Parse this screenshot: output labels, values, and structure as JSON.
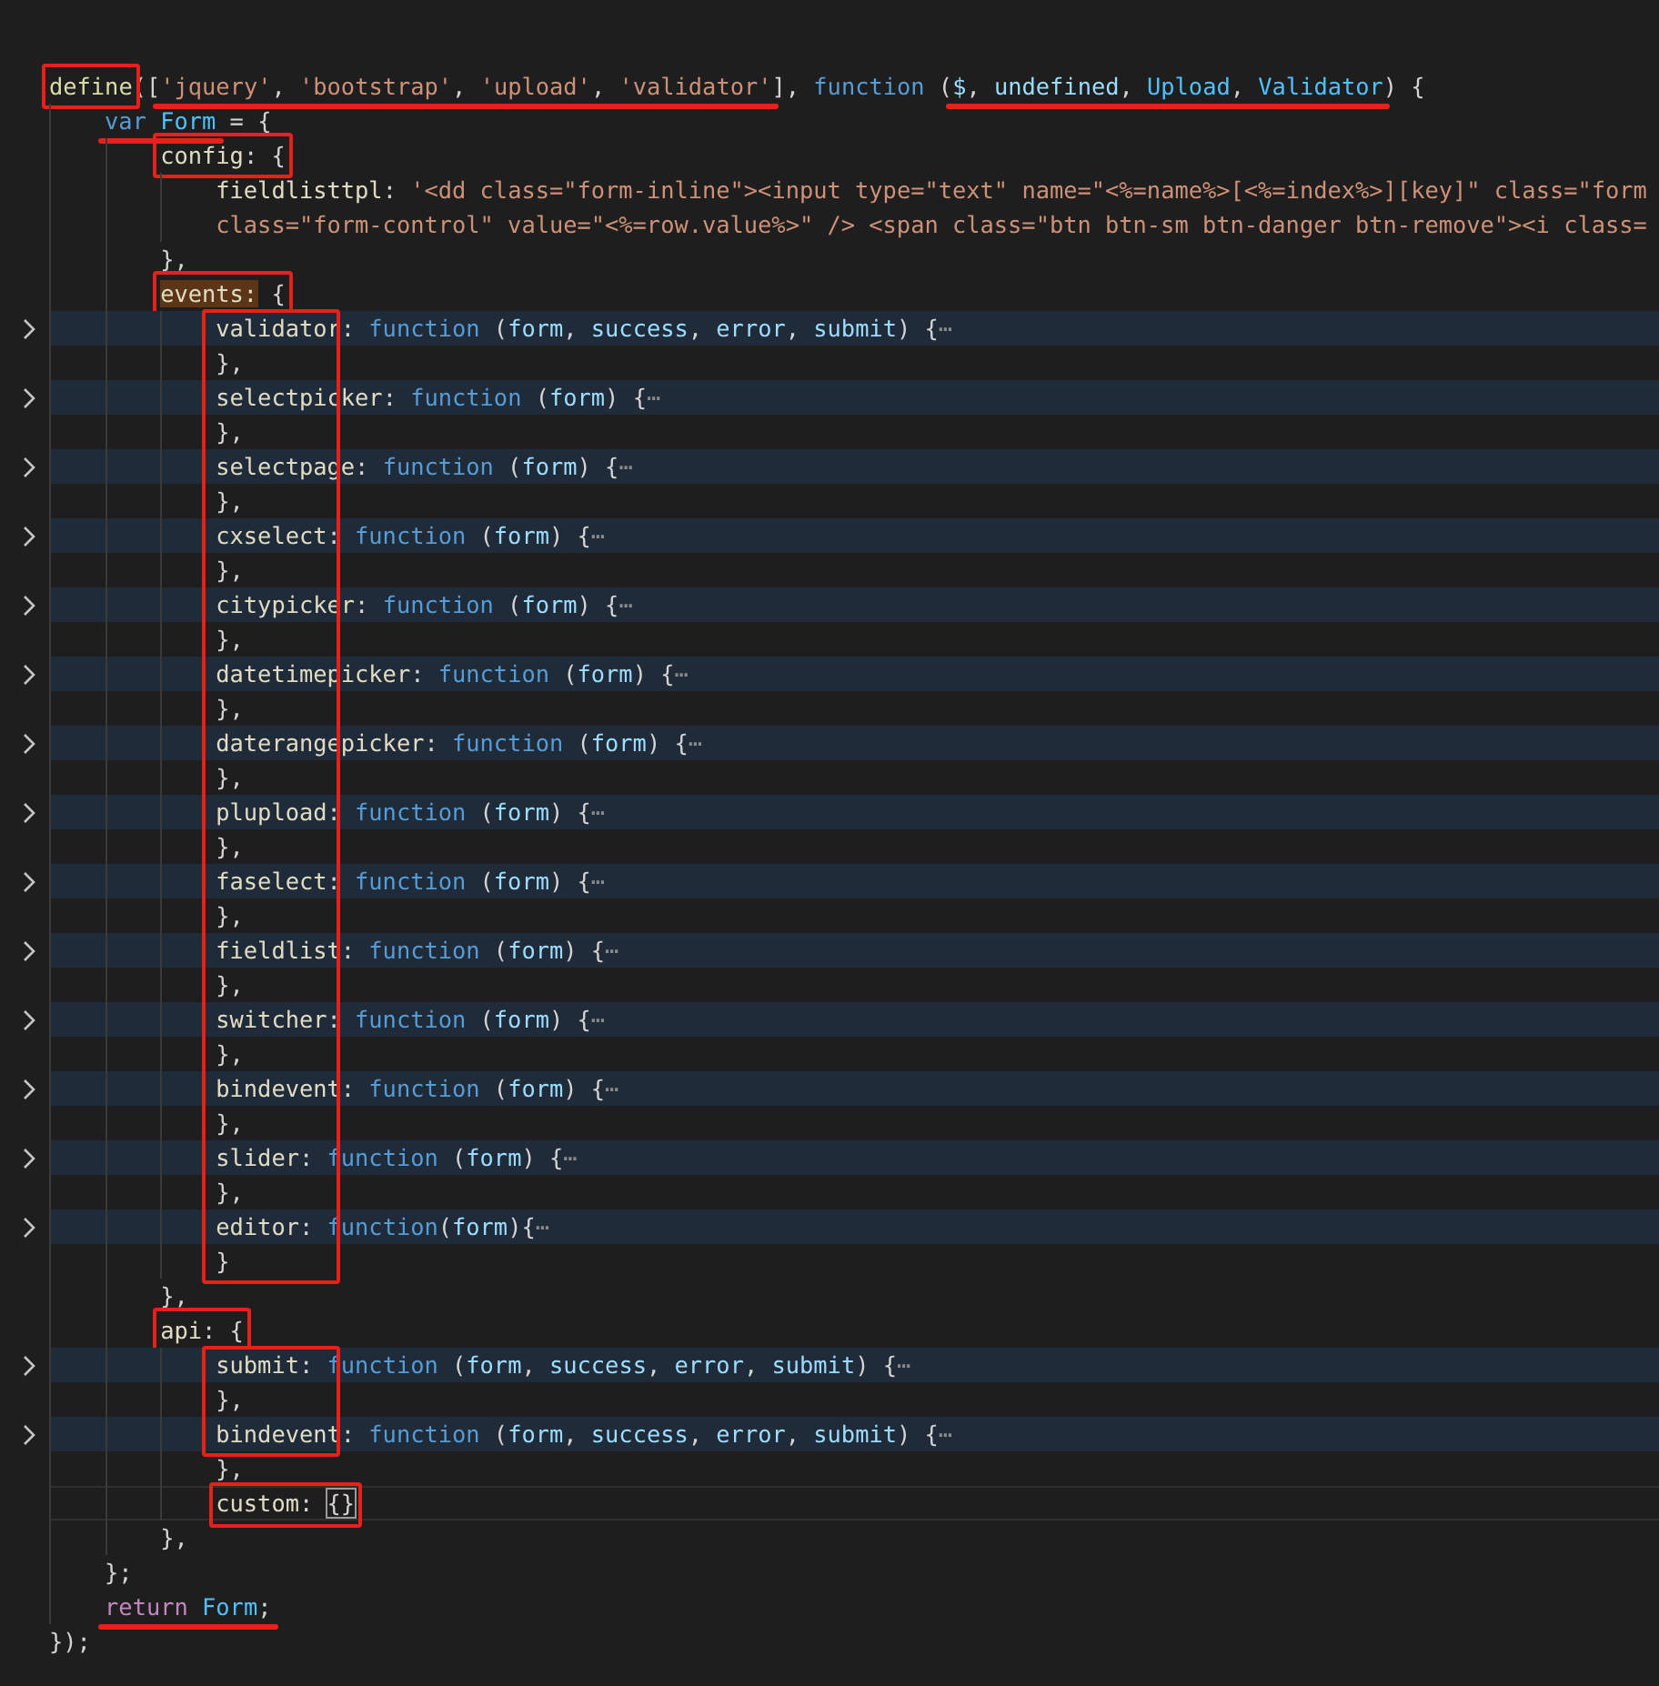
{
  "editor": {
    "lines": [
      {
        "tokens": [
          {
            "kind": "fn",
            "text": "define",
            "box_from": true,
            "box_to": true
          },
          {
            "kind": "p",
            "text": "(["
          },
          {
            "kind": "str",
            "text": "'jquery'",
            "underline_from": true
          },
          {
            "kind": "p",
            "text": ", "
          },
          {
            "kind": "str",
            "text": "'bootstrap'"
          },
          {
            "kind": "p",
            "text": ", "
          },
          {
            "kind": "str",
            "text": "'upload'"
          },
          {
            "kind": "p",
            "text": ", "
          },
          {
            "kind": "str",
            "text": "'validator'",
            "underline_to": true
          },
          {
            "kind": "p",
            "text": "], "
          },
          {
            "kind": "kw",
            "text": "function"
          },
          {
            "kind": "p",
            "text": " ("
          },
          {
            "kind": "param",
            "text": "$",
            "underline_from": true
          },
          {
            "kind": "p",
            "text": ", "
          },
          {
            "kind": "param",
            "text": "undefined"
          },
          {
            "kind": "p",
            "text": ", "
          },
          {
            "kind": "cls",
            "text": "Upload"
          },
          {
            "kind": "p",
            "text": ", "
          },
          {
            "kind": "cls",
            "text": "Validator",
            "underline_to": true
          },
          {
            "kind": "p",
            "text": ") {"
          }
        ],
        "children": [
          {
            "tokens": [
              {
                "kind": "kw",
                "text": "var ",
                "underline_from": true
              },
              {
                "kind": "cls",
                "text": "Form",
                "underline_to": true
              },
              {
                "kind": "p",
                "text": " = {"
              }
            ],
            "children": [
              {
                "tokens": [
                  {
                    "kind": "key",
                    "text": "config",
                    "box_from": true
                  },
                  {
                    "kind": "p",
                    "text": ": {",
                    "box_to": true
                  }
                ],
                "children": [
                  {
                    "tokens": [
                      {
                        "kind": "key",
                        "text": "fieldlisttpl"
                      },
                      {
                        "kind": "p",
                        "text": ": "
                      },
                      {
                        "kind": "str",
                        "text": "'<dd class=\"form-inline\"><input type=\"text\" name=\"<%=name%>[<%=index%>][key]\" class=\"form"
                      }
                    ]
                  },
                  {
                    "tokens": [
                      {
                        "kind": "str",
                        "text": "class=\"form-control\" value=\"<%=row.value%>\" /> <span class=\"btn btn-sm btn-danger btn-remove\"><i class="
                      }
                    ]
                  }
                ]
              },
              {
                "tokens": [
                  {
                    "kind": "p",
                    "text": "},"
                  }
                ]
              },
              {
                "tokens": [
                  {
                    "kind": "key",
                    "text": "events:",
                    "highlight": true,
                    "box_from": true
                  },
                  {
                    "kind": "p",
                    "text": " {",
                    "box_to": true
                  }
                ],
                "children": [
                  {
                    "box_from": true,
                    "folded": true,
                    "tokens": [
                      {
                        "kind": "key",
                        "text": "validator"
                      },
                      {
                        "kind": "p",
                        "text": ": "
                      },
                      {
                        "kind": "kw",
                        "text": "function"
                      },
                      {
                        "kind": "p",
                        "text": " ("
                      },
                      {
                        "kind": "param",
                        "text": "form"
                      },
                      {
                        "kind": "p",
                        "text": ", "
                      },
                      {
                        "kind": "param",
                        "text": "success"
                      },
                      {
                        "kind": "p",
                        "text": ", "
                      },
                      {
                        "kind": "param",
                        "text": "error"
                      },
                      {
                        "kind": "p",
                        "text": ", "
                      },
                      {
                        "kind": "param",
                        "text": "submit"
                      },
                      {
                        "kind": "p",
                        "text": ") {"
                      },
                      {
                        "kind": "fold",
                        "text": "⋯"
                      }
                    ]
                  },
                  {
                    "tokens": [
                      {
                        "kind": "p",
                        "text": "},"
                      }
                    ]
                  },
                  {
                    "folded": true,
                    "tokens": [
                      {
                        "kind": "key",
                        "text": "selectpicker"
                      },
                      {
                        "kind": "p",
                        "text": ": "
                      },
                      {
                        "kind": "kw",
                        "text": "function"
                      },
                      {
                        "kind": "p",
                        "text": " ("
                      },
                      {
                        "kind": "param",
                        "text": "form"
                      },
                      {
                        "kind": "p",
                        "text": ") {"
                      },
                      {
                        "kind": "fold",
                        "text": "⋯"
                      }
                    ]
                  },
                  {
                    "tokens": [
                      {
                        "kind": "p",
                        "text": "},"
                      }
                    ]
                  },
                  {
                    "folded": true,
                    "tokens": [
                      {
                        "kind": "key",
                        "text": "selectpage"
                      },
                      {
                        "kind": "p",
                        "text": ": "
                      },
                      {
                        "kind": "kw",
                        "text": "function"
                      },
                      {
                        "kind": "p",
                        "text": " ("
                      },
                      {
                        "kind": "param",
                        "text": "form"
                      },
                      {
                        "kind": "p",
                        "text": ") {"
                      },
                      {
                        "kind": "fold",
                        "text": "⋯"
                      }
                    ]
                  },
                  {
                    "tokens": [
                      {
                        "kind": "p",
                        "text": "},"
                      }
                    ]
                  },
                  {
                    "folded": true,
                    "tokens": [
                      {
                        "kind": "key",
                        "text": "cxselect"
                      },
                      {
                        "kind": "p",
                        "text": ": "
                      },
                      {
                        "kind": "kw",
                        "text": "function"
                      },
                      {
                        "kind": "p",
                        "text": " ("
                      },
                      {
                        "kind": "param",
                        "text": "form"
                      },
                      {
                        "kind": "p",
                        "text": ") {"
                      },
                      {
                        "kind": "fold",
                        "text": "⋯"
                      }
                    ]
                  },
                  {
                    "tokens": [
                      {
                        "kind": "p",
                        "text": "},"
                      }
                    ]
                  },
                  {
                    "folded": true,
                    "tokens": [
                      {
                        "kind": "key",
                        "text": "citypicker"
                      },
                      {
                        "kind": "p",
                        "text": ": "
                      },
                      {
                        "kind": "kw",
                        "text": "function"
                      },
                      {
                        "kind": "p",
                        "text": " ("
                      },
                      {
                        "kind": "param",
                        "text": "form"
                      },
                      {
                        "kind": "p",
                        "text": ") {"
                      },
                      {
                        "kind": "fold",
                        "text": "⋯"
                      }
                    ]
                  },
                  {
                    "tokens": [
                      {
                        "kind": "p",
                        "text": "},"
                      }
                    ]
                  },
                  {
                    "folded": true,
                    "tokens": [
                      {
                        "kind": "key",
                        "text": "datetimepicker"
                      },
                      {
                        "kind": "p",
                        "text": ": "
                      },
                      {
                        "kind": "kw",
                        "text": "function"
                      },
                      {
                        "kind": "p",
                        "text": " ("
                      },
                      {
                        "kind": "param",
                        "text": "form"
                      },
                      {
                        "kind": "p",
                        "text": ") {"
                      },
                      {
                        "kind": "fold",
                        "text": "⋯"
                      }
                    ]
                  },
                  {
                    "tokens": [
                      {
                        "kind": "p",
                        "text": "},"
                      }
                    ]
                  },
                  {
                    "folded": true,
                    "tokens": [
                      {
                        "kind": "key",
                        "text": "daterangepicker"
                      },
                      {
                        "kind": "p",
                        "text": ": "
                      },
                      {
                        "kind": "kw",
                        "text": "function"
                      },
                      {
                        "kind": "p",
                        "text": " ("
                      },
                      {
                        "kind": "param",
                        "text": "form"
                      },
                      {
                        "kind": "p",
                        "text": ") {"
                      },
                      {
                        "kind": "fold",
                        "text": "⋯"
                      }
                    ]
                  },
                  {
                    "tokens": [
                      {
                        "kind": "p",
                        "text": "},"
                      }
                    ]
                  },
                  {
                    "folded": true,
                    "tokens": [
                      {
                        "kind": "key",
                        "text": "plupload"
                      },
                      {
                        "kind": "p",
                        "text": ": "
                      },
                      {
                        "kind": "kw",
                        "text": "function"
                      },
                      {
                        "kind": "p",
                        "text": " ("
                      },
                      {
                        "kind": "param",
                        "text": "form"
                      },
                      {
                        "kind": "p",
                        "text": ") {"
                      },
                      {
                        "kind": "fold",
                        "text": "⋯"
                      }
                    ]
                  },
                  {
                    "tokens": [
                      {
                        "kind": "p",
                        "text": "},"
                      }
                    ]
                  },
                  {
                    "folded": true,
                    "tokens": [
                      {
                        "kind": "key",
                        "text": "faselect"
                      },
                      {
                        "kind": "p",
                        "text": ": "
                      },
                      {
                        "kind": "kw",
                        "text": "function"
                      },
                      {
                        "kind": "p",
                        "text": " ("
                      },
                      {
                        "kind": "param",
                        "text": "form"
                      },
                      {
                        "kind": "p",
                        "text": ") {"
                      },
                      {
                        "kind": "fold",
                        "text": "⋯"
                      }
                    ]
                  },
                  {
                    "tokens": [
                      {
                        "kind": "p",
                        "text": "},"
                      }
                    ]
                  },
                  {
                    "folded": true,
                    "tokens": [
                      {
                        "kind": "key",
                        "text": "fieldlist"
                      },
                      {
                        "kind": "p",
                        "text": ": "
                      },
                      {
                        "kind": "kw",
                        "text": "function"
                      },
                      {
                        "kind": "p",
                        "text": " ("
                      },
                      {
                        "kind": "param",
                        "text": "form"
                      },
                      {
                        "kind": "p",
                        "text": ") {"
                      },
                      {
                        "kind": "fold",
                        "text": "⋯"
                      }
                    ]
                  },
                  {
                    "tokens": [
                      {
                        "kind": "p",
                        "text": "},"
                      }
                    ]
                  },
                  {
                    "folded": true,
                    "tokens": [
                      {
                        "kind": "key",
                        "text": "switcher"
                      },
                      {
                        "kind": "p",
                        "text": ": "
                      },
                      {
                        "kind": "kw",
                        "text": "function"
                      },
                      {
                        "kind": "p",
                        "text": " ("
                      },
                      {
                        "kind": "param",
                        "text": "form"
                      },
                      {
                        "kind": "p",
                        "text": ") {"
                      },
                      {
                        "kind": "fold",
                        "text": "⋯"
                      }
                    ]
                  },
                  {
                    "tokens": [
                      {
                        "kind": "p",
                        "text": "},"
                      }
                    ]
                  },
                  {
                    "folded": true,
                    "tokens": [
                      {
                        "kind": "key",
                        "text": "bindevent"
                      },
                      {
                        "kind": "p",
                        "text": ": "
                      },
                      {
                        "kind": "kw",
                        "text": "function"
                      },
                      {
                        "kind": "p",
                        "text": " ("
                      },
                      {
                        "kind": "param",
                        "text": "form"
                      },
                      {
                        "kind": "p",
                        "text": ") {"
                      },
                      {
                        "kind": "fold",
                        "text": "⋯"
                      }
                    ]
                  },
                  {
                    "tokens": [
                      {
                        "kind": "p",
                        "text": "},"
                      }
                    ]
                  },
                  {
                    "folded": true,
                    "tokens": [
                      {
                        "kind": "key",
                        "text": "slider"
                      },
                      {
                        "kind": "p",
                        "text": ": "
                      },
                      {
                        "kind": "kw",
                        "text": "function"
                      },
                      {
                        "kind": "p",
                        "text": " ("
                      },
                      {
                        "kind": "param",
                        "text": "form"
                      },
                      {
                        "kind": "p",
                        "text": ") {"
                      },
                      {
                        "kind": "fold",
                        "text": "⋯"
                      }
                    ]
                  },
                  {
                    "tokens": [
                      {
                        "kind": "p",
                        "text": "},"
                      }
                    ]
                  },
                  {
                    "folded": true,
                    "tokens": [
                      {
                        "kind": "key",
                        "text": "editor"
                      },
                      {
                        "kind": "p",
                        "text": ": "
                      },
                      {
                        "kind": "kw",
                        "text": "function"
                      },
                      {
                        "kind": "p",
                        "text": "("
                      },
                      {
                        "kind": "param",
                        "text": "form"
                      },
                      {
                        "kind": "p",
                        "text": "){"
                      },
                      {
                        "kind": "fold",
                        "text": "⋯"
                      }
                    ]
                  },
                  {
                    "box_to": true,
                    "tokens": [
                      {
                        "kind": "p",
                        "text": "}"
                      }
                    ]
                  }
                ]
              },
              {
                "tokens": [
                  {
                    "kind": "p",
                    "text": "},"
                  }
                ]
              },
              {
                "tokens": [
                  {
                    "kind": "key",
                    "text": "api",
                    "box_from": true
                  },
                  {
                    "kind": "p",
                    "text": ": {",
                    "box_to": true
                  }
                ],
                "children": [
                  {
                    "box_from": true,
                    "folded": true,
                    "tokens": [
                      {
                        "kind": "key",
                        "text": "submit"
                      },
                      {
                        "kind": "p",
                        "text": ": "
                      },
                      {
                        "kind": "kw",
                        "text": "function"
                      },
                      {
                        "kind": "p",
                        "text": " ("
                      },
                      {
                        "kind": "param",
                        "text": "form"
                      },
                      {
                        "kind": "p",
                        "text": ", "
                      },
                      {
                        "kind": "param",
                        "text": "success"
                      },
                      {
                        "kind": "p",
                        "text": ", "
                      },
                      {
                        "kind": "param",
                        "text": "error"
                      },
                      {
                        "kind": "p",
                        "text": ", "
                      },
                      {
                        "kind": "param",
                        "text": "submit"
                      },
                      {
                        "kind": "p",
                        "text": ") {"
                      },
                      {
                        "kind": "fold",
                        "text": "⋯"
                      }
                    ]
                  },
                  {
                    "tokens": [
                      {
                        "kind": "p",
                        "text": "},"
                      }
                    ]
                  },
                  {
                    "box_to": true,
                    "folded": true,
                    "tokens": [
                      {
                        "kind": "key",
                        "text": "bindevent"
                      },
                      {
                        "kind": "p",
                        "text": ": "
                      },
                      {
                        "kind": "kw",
                        "text": "function"
                      },
                      {
                        "kind": "p",
                        "text": " ("
                      },
                      {
                        "kind": "param",
                        "text": "form"
                      },
                      {
                        "kind": "p",
                        "text": ", "
                      },
                      {
                        "kind": "param",
                        "text": "success"
                      },
                      {
                        "kind": "p",
                        "text": ", "
                      },
                      {
                        "kind": "param",
                        "text": "error"
                      },
                      {
                        "kind": "p",
                        "text": ", "
                      },
                      {
                        "kind": "param",
                        "text": "submit"
                      },
                      {
                        "kind": "p",
                        "text": ") {"
                      },
                      {
                        "kind": "fold",
                        "text": "⋯"
                      }
                    ]
                  },
                  {
                    "tokens": [
                      {
                        "kind": "p",
                        "text": "},"
                      }
                    ]
                  },
                  {
                    "current": true,
                    "tokens": [
                      {
                        "kind": "key",
                        "text": "custom",
                        "box_from": true
                      },
                      {
                        "kind": "p",
                        "text": ": "
                      },
                      {
                        "kind": "match",
                        "text": "{}",
                        "box_to": true
                      }
                    ]
                  }
                ]
              },
              {
                "tokens": [
                  {
                    "kind": "p",
                    "text": "},"
                  }
                ]
              }
            ]
          },
          {
            "tokens": [
              {
                "kind": "p",
                "text": "};"
              }
            ]
          },
          {
            "tokens": [
              {
                "kind": "ret",
                "text": "return ",
                "underline_from": true
              },
              {
                "kind": "cls",
                "text": "Form"
              },
              {
                "kind": "p",
                "text": ";",
                "underline_to": true
              }
            ]
          }
        ]
      },
      {
        "tokens": [
          {
            "kind": "p",
            "text": "});"
          }
        ]
      }
    ]
  }
}
